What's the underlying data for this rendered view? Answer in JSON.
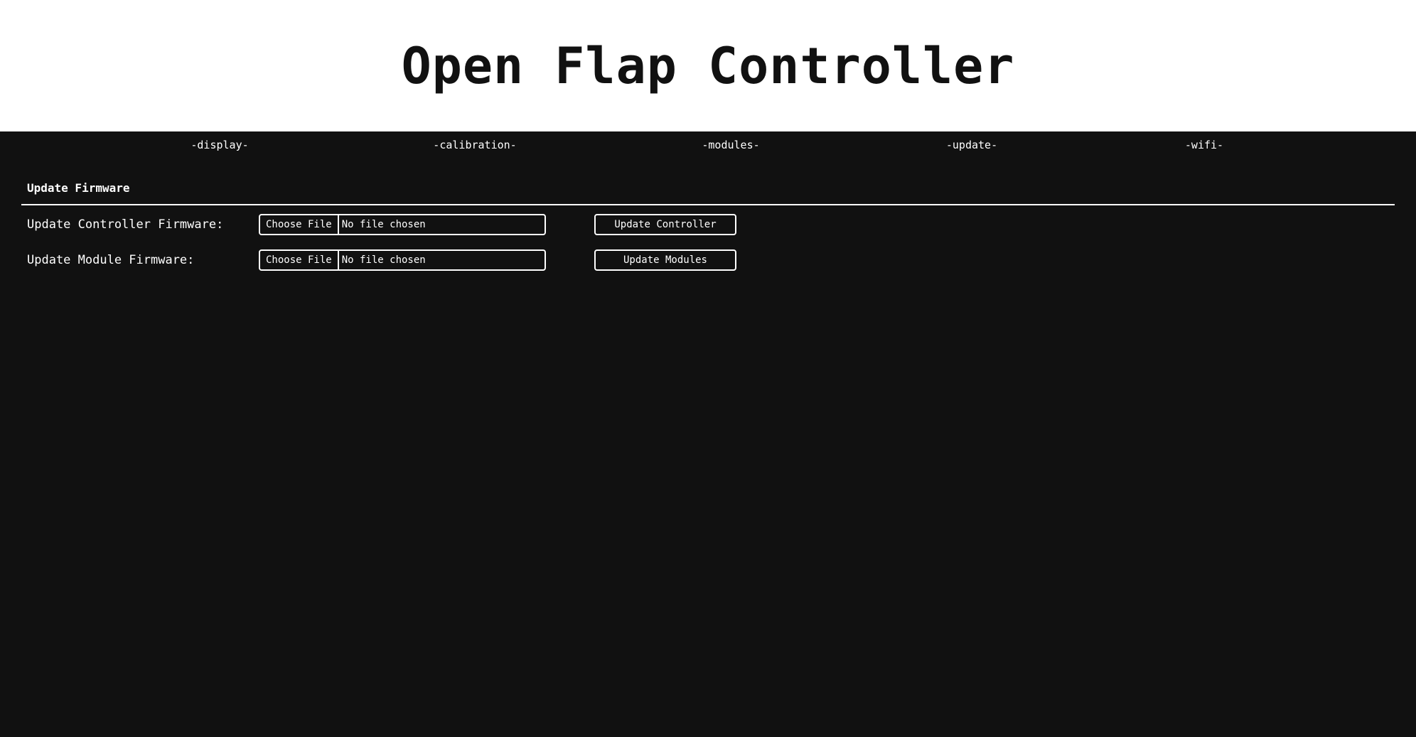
{
  "header": {
    "title": "Open Flap Controller"
  },
  "nav": {
    "items": [
      {
        "label": "-display-"
      },
      {
        "label": "-calibration-"
      },
      {
        "label": "-modules-"
      },
      {
        "label": "-update-"
      },
      {
        "label": "-wifi-"
      }
    ]
  },
  "update_section": {
    "title": "Update Firmware",
    "controller": {
      "label": "Update Controller Firmware:",
      "choose_label": "Choose File",
      "file_status": "No file chosen",
      "button_label": "Update Controller"
    },
    "module": {
      "label": "Update Module Firmware:",
      "choose_label": "Choose File",
      "file_status": "No file chosen",
      "button_label": "Update Modules"
    }
  },
  "colors": {
    "background": "#111111",
    "header_background": "#ffffff",
    "text": "#ffffff"
  }
}
